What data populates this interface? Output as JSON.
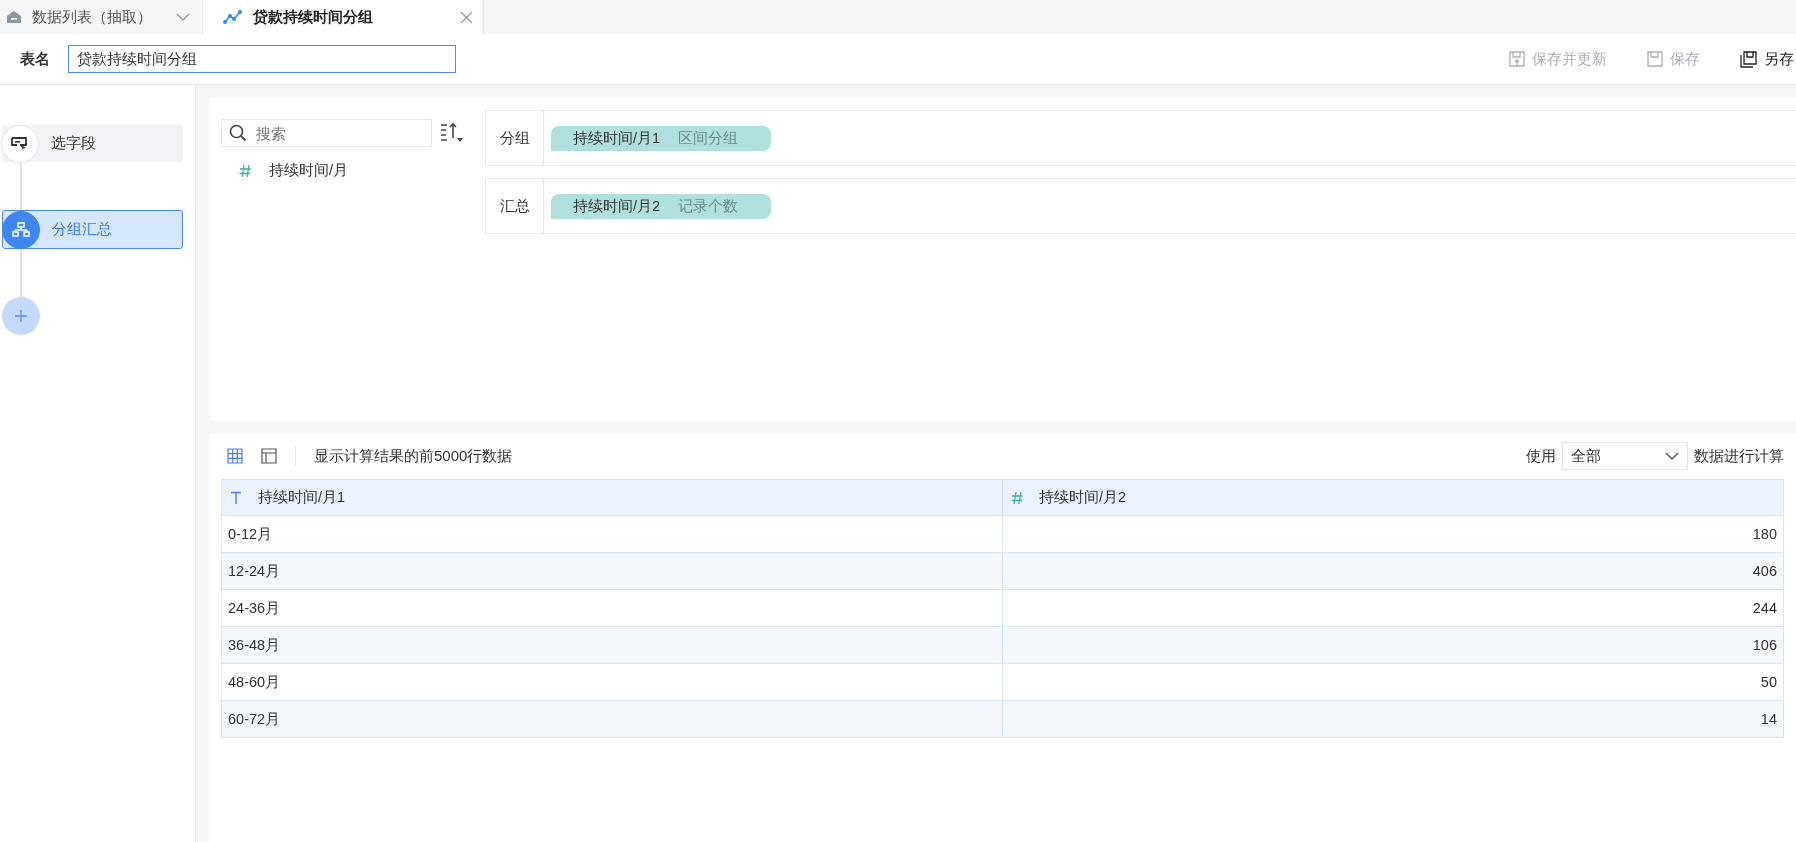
{
  "tabs": [
    {
      "label": "数据列表（抽取）",
      "selected": false,
      "kind": "home"
    },
    {
      "label": "贷款持续时间分组",
      "selected": true,
      "kind": "analysis"
    }
  ],
  "toolbar": {
    "name_label": "表名",
    "name_value": "贷款持续时间分组",
    "actions": [
      {
        "label": "保存并更新",
        "disabled": true,
        "kind": "update"
      },
      {
        "label": "保存",
        "disabled": true,
        "kind": "save"
      },
      {
        "label": "另存",
        "disabled": false,
        "kind": "saveas"
      }
    ]
  },
  "steps": [
    {
      "label": "选字段",
      "selected": false,
      "kind": "fields"
    },
    {
      "label": "分组汇总",
      "selected": true,
      "kind": "group"
    }
  ],
  "field_search": {
    "placeholder": "搜索"
  },
  "fields": [
    {
      "name": "持续时间/月",
      "kind": "number"
    }
  ],
  "config": [
    {
      "label": "分组",
      "field": "持续时间/月1",
      "method": "区间分组"
    },
    {
      "label": "汇总",
      "field": "持续时间/月2",
      "method": "记录个数"
    }
  ],
  "preview": {
    "info": "显示计算结果的前5000行数据",
    "use_label": "使用",
    "scope": "全部",
    "suffix": "数据进行计算",
    "columns": [
      {
        "name": "持续时间/月1",
        "kind": "text"
      },
      {
        "name": "持续时间/月2",
        "kind": "number"
      }
    ],
    "rows": [
      [
        "0-12月",
        "180"
      ],
      [
        "12-24月",
        "406"
      ],
      [
        "24-36月",
        "244"
      ],
      [
        "36-48月",
        "106"
      ],
      [
        "48-60月",
        "50"
      ],
      [
        "60-72月",
        "14"
      ]
    ]
  }
}
